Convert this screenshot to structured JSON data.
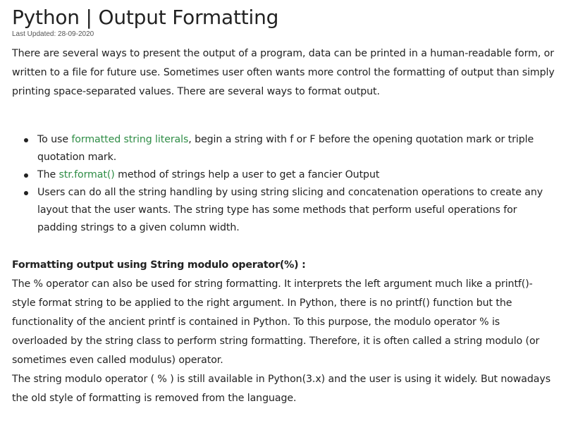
{
  "header": {
    "title": "Python | Output Formatting",
    "last_updated": "Last Updated: 28-09-2020"
  },
  "intro": {
    "text": "There are several ways to present the output of a program, data can be printed in a human-readable form, or written to a file for future use. Sometimes user often wants more control the formatting of output than simply printing space-separated values. There are several ways to format output."
  },
  "bullets": [
    {
      "before": "To use ",
      "link": "formatted string literals",
      "after": ", begin a string with f or F before the opening quotation mark or triple quotation mark."
    },
    {
      "before": "The ",
      "link": "str.format()",
      "after": " method of strings help a user to get a fancier Output"
    },
    {
      "text": "Users can do all the string handling by using string slicing and concatenation operations to create any layout that the user wants. The string type has some methods that perform useful operations for padding strings to a given column width."
    }
  ],
  "section": {
    "heading": "Formatting output using String modulo operator(%) :",
    "paragraph1": "The % operator can also be used for string formatting. It interprets the left argument much like a printf()-style format string to be applied to the right argument. In Python, there is no printf() function but the functionality of the ancient printf is contained in Python. To this purpose, the modulo operator % is overloaded by the string class to perform string formatting. Therefore, it is often called a string modulo (or sometimes even called modulus) operator.",
    "paragraph2": "The string modulo operator ( % ) is still available in Python(3.x) and the user is using it widely. But nowadays the old style of formatting is removed from the language."
  },
  "colors": {
    "text": "#222222",
    "link": "#2f8d46",
    "muted": "#555555"
  }
}
